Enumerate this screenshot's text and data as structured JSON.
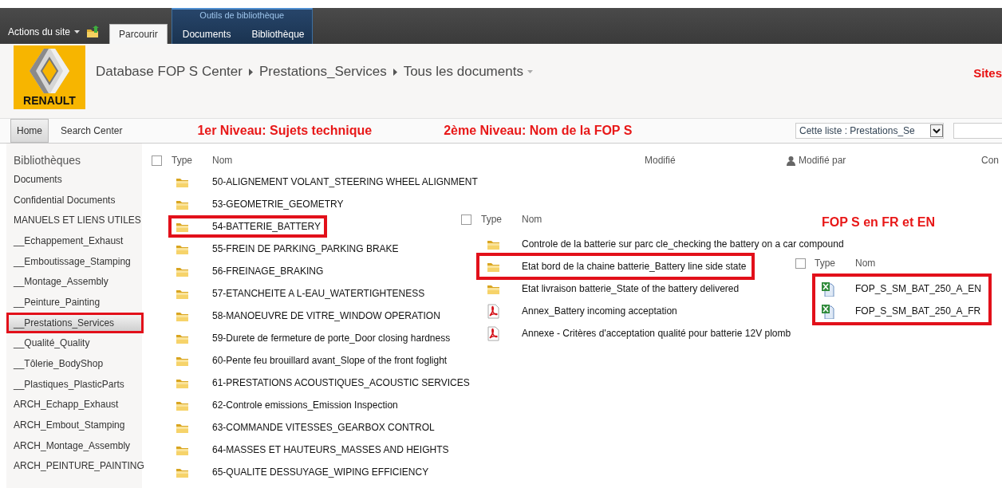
{
  "ribbon": {
    "site_actions": "Actions du site",
    "tabs": [
      {
        "label": "Parcourir",
        "selected": true
      }
    ],
    "tool_group": {
      "title": "Outils de bibliothèque",
      "tabs": [
        {
          "label": "Documents",
          "selected": false
        },
        {
          "label": "Bibliothèque",
          "selected": false
        }
      ]
    }
  },
  "header": {
    "logo_text": "RENAULT",
    "breadcrumb": [
      "Database FOP S Center",
      "Prestations_Services",
      "Tous les documents"
    ],
    "side_text": "Sites"
  },
  "nav": {
    "tabs": [
      {
        "label": "Home",
        "selected": true
      },
      {
        "label": "Search Center",
        "selected": false
      }
    ],
    "search_scope": "Cette liste : Prestations_Se"
  },
  "annotations": [
    "1er Niveau: Sujets technique",
    "2ème Niveau: Nom de la FOP S",
    "FOP S en FR et EN"
  ],
  "sidebar": {
    "heading": "Bibliothèques",
    "items": [
      {
        "label": "Documents",
        "selected": false,
        "highlighted": false
      },
      {
        "label": "Confidential Documents",
        "selected": false,
        "highlighted": false
      },
      {
        "label": "MANUELS ET LIENS UTILES",
        "selected": false,
        "highlighted": false
      },
      {
        "label": "__Echappement_Exhaust",
        "selected": false,
        "highlighted": false
      },
      {
        "label": "__Emboutissage_Stamping",
        "selected": false,
        "highlighted": false
      },
      {
        "label": "__Montage_Assembly",
        "selected": false,
        "highlighted": false
      },
      {
        "label": "__Peinture_Painting",
        "selected": false,
        "highlighted": false
      },
      {
        "label": "__Prestations_Services",
        "selected": true,
        "highlighted": true
      },
      {
        "label": "__Qualité_Quality",
        "selected": false,
        "highlighted": false
      },
      {
        "label": "__Tôlerie_BodyShop",
        "selected": false,
        "highlighted": false
      },
      {
        "label": "__Plastiques_PlasticParts",
        "selected": false,
        "highlighted": false
      },
      {
        "label": "ARCH_Echapp_Exhaust",
        "selected": false,
        "highlighted": false
      },
      {
        "label": "ARCH_Embout_Stamping",
        "selected": false,
        "highlighted": false
      },
      {
        "label": "ARCH_Montage_Assembly",
        "selected": false,
        "highlighted": false
      },
      {
        "label": "ARCH_PEINTURE_PAINTING",
        "selected": false,
        "highlighted": false
      }
    ]
  },
  "library": {
    "columns": [
      "Type",
      "Nom",
      "Modifié",
      "Modifié par",
      "Con"
    ],
    "select_all_checked": false,
    "rows": [
      {
        "kind": "folder",
        "name": "50-ALIGNEMENT VOLANT_STEERING WHEEL ALIGNMENT",
        "highlighted": false
      },
      {
        "kind": "folder",
        "name": "53-GEOMETRIE_GEOMETRY",
        "highlighted": false
      },
      {
        "kind": "folder",
        "name": "54-BATTERIE_BATTERY",
        "highlighted": true
      },
      {
        "kind": "folder",
        "name": "55-FREIN DE PARKING_PARKING BRAKE",
        "highlighted": false
      },
      {
        "kind": "folder",
        "name": "56-FREINAGE_BRAKING",
        "highlighted": false
      },
      {
        "kind": "folder",
        "name": "57-ETANCHEITE A L-EAU_WATERTIGHTENESS",
        "highlighted": false
      },
      {
        "kind": "folder",
        "name": "58-MANOEUVRE DE VITRE_WINDOW OPERATION",
        "highlighted": false
      },
      {
        "kind": "folder",
        "name": "59-Durete de fermeture de porte_Door closing hardness",
        "highlighted": false
      },
      {
        "kind": "folder",
        "name": "60-Pente feu brouillard avant_Slope of the front foglight",
        "highlighted": false
      },
      {
        "kind": "folder",
        "name": "61-PRESTATIONS ACOUSTIQUES_ACOUSTIC SERVICES",
        "highlighted": false
      },
      {
        "kind": "folder",
        "name": "62-Controle emissions_Emission Inspection",
        "highlighted": false
      },
      {
        "kind": "folder",
        "name": "63-COMMANDE VITESSES_GEARBOX CONTROL",
        "highlighted": false
      },
      {
        "kind": "folder",
        "name": "64-MASSES ET HAUTEURS_MASSES AND HEIGHTS",
        "highlighted": false
      },
      {
        "kind": "folder",
        "name": "65-QUALITE DESSUYAGE_WIPING EFFICIENCY",
        "highlighted": false
      }
    ]
  },
  "subfolder_panel": {
    "columns": [
      "Type",
      "Nom"
    ],
    "select_all_checked": false,
    "rows": [
      {
        "kind": "folder",
        "name": "Controle de la batterie sur parc cle_checking the battery on a car compound",
        "highlighted": false
      },
      {
        "kind": "folder",
        "name": "Etat bord de la chaine batterie_Battery line side state",
        "highlighted": true
      },
      {
        "kind": "folder",
        "name": "Etat livraison batterie_State of the battery delivered",
        "highlighted": false
      },
      {
        "kind": "pdf",
        "name": "Annex_Battery incoming acceptation",
        "highlighted": false
      },
      {
        "kind": "pdf",
        "name": "Annexe - Critères d'acceptation qualité pour batterie 12V plomb",
        "highlighted": false
      }
    ]
  },
  "file_panel": {
    "columns": [
      "Type",
      "Nom"
    ],
    "select_all_checked": false,
    "highlighted": true,
    "rows": [
      {
        "kind": "excel",
        "name": "FOP_S_SM_BAT_250_A_EN"
      },
      {
        "kind": "excel",
        "name": "FOP_S_SM_BAT_250_A_FR"
      }
    ]
  }
}
